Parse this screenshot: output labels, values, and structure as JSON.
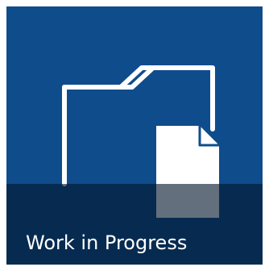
{
  "tile": {
    "label": "Work in Progress",
    "icon": "folder-document-icon",
    "colors": {
      "background": "#0f4c8c",
      "caption_bar": "#03162c",
      "icon_stroke": "#ffffff",
      "text": "#ffffff"
    }
  }
}
